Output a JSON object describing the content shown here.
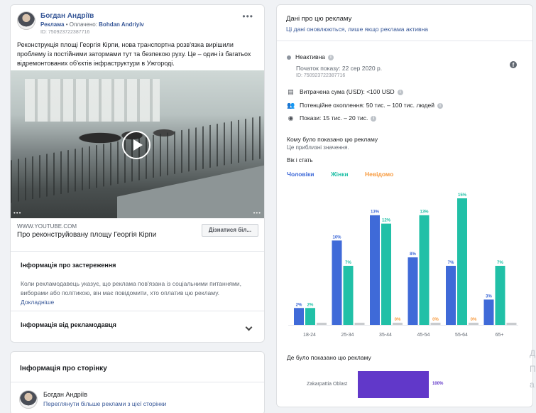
{
  "ad": {
    "page_name": "Богдан Андріїв",
    "sponsored_label": "Реклама",
    "paid_by_prefix": " • Оплачено: ",
    "paid_by": "Bohdan Andriyiv",
    "id_line": "ID: 750923722387716",
    "more_dots": "•••",
    "text": "Реконструкція площі Георгія Кірпи, нова транспортна розв'язка вирішили проблему із постійними затормами тут та безпекою руху. Це – один із багатьох відремонтованих об'єктів інфраструктури в Ужгороді.",
    "link_domain": "WWW.YOUTUBE.COM",
    "link_title": "Про реконструйовану площу Георгія Кірпи",
    "cta_label": "Дізнатися біл...",
    "disclaimer_title": "Інформація про застереження",
    "disclaimer_text": "Коли рекламодавець указує, що реклама пов'язана із соціальними питаннями, виборами або політикою, він має повідомити, хто оплатив цю рекламу.",
    "disclaimer_more": "Докладніше",
    "advertiser_info": "Інформація від рекламодавця"
  },
  "page_info": {
    "title": "Інформація про сторінку",
    "name": "Богдан Андріїв",
    "more_link": "Переглянути більше реклами з цієї сторінки"
  },
  "info": {
    "title": "Дані про цю рекламу",
    "subtitle": "Ці дані оновлюються, лише якщо реклама активна",
    "status": "Неактивна",
    "start_date": "Початок показу: 22 сер 2020 р.",
    "id_line": "ID: 750923722387716",
    "spend_label": "Витрачена сума (USD): ",
    "spend_value": "<100 USD",
    "reach_label": "Потенційне охоплення: ",
    "reach_value": "50 тис. – 100 тис. людей",
    "impressions_label": "Покази: ",
    "impressions_value": "15 тис. – 20 тис.",
    "who_title": "Кому було показано цю рекламу",
    "who_sub": "Це приблизні значення.",
    "age_gender_label": "Вік і стать",
    "where_title": "Де було показано цю рекламу",
    "region_name": "Zakarpattia Oblast",
    "region_pct": "100%"
  },
  "colors": {
    "men": "#3f6ad8",
    "women": "#21c0a7",
    "unknown": "#f79a3e",
    "unknown_bar": "#c9cccf",
    "region": "#6138c9"
  },
  "chart_data": {
    "type": "bar",
    "categories": [
      "18-24",
      "25-34",
      "35-44",
      "45-54",
      "55-64",
      "65+"
    ],
    "series": [
      {
        "name": "Чоловіки",
        "values": [
          2,
          10,
          13,
          8,
          7,
          3
        ]
      },
      {
        "name": "Жінки",
        "values": [
          2,
          7,
          12,
          13,
          15,
          7
        ]
      },
      {
        "name": "Невідомо",
        "values": [
          0,
          0,
          0,
          0,
          0,
          0
        ]
      }
    ],
    "ylim": [
      0,
      15
    ],
    "legend": "top-left"
  },
  "edge_text": [
    "Д",
    "П",
    "а"
  ]
}
